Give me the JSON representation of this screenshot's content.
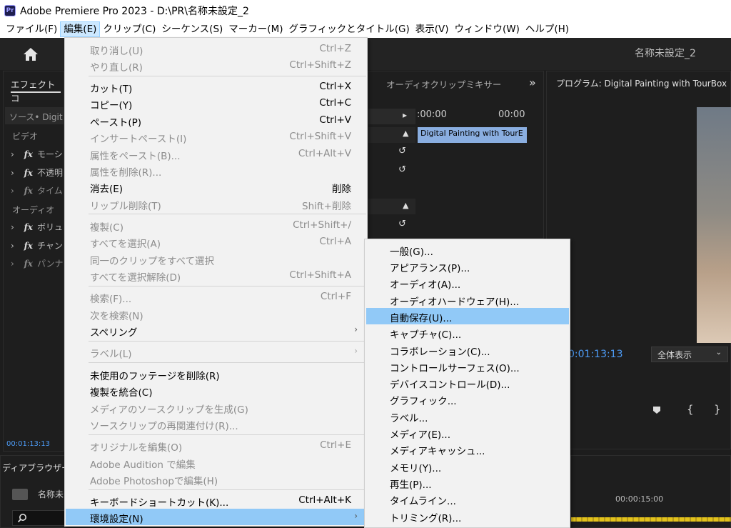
{
  "window": {
    "app_logo": "Pr",
    "title": "Adobe Premiere Pro 2023 - D:\\PR\\名称未設定_2"
  },
  "menubar": [
    {
      "label": "ファイル(F)"
    },
    {
      "label": "編集(E)"
    },
    {
      "label": "クリップ(C)"
    },
    {
      "label": "シーケンス(S)"
    },
    {
      "label": "マーカー(M)"
    },
    {
      "label": "グラフィックとタイトル(G)"
    },
    {
      "label": "表示(V)"
    },
    {
      "label": "ウィンドウ(W)"
    },
    {
      "label": "ヘルプ(H)"
    }
  ],
  "header": {
    "project_name": "名称未設定_2",
    "home_icon": "home-icon"
  },
  "effect_controls": {
    "tab_label": "エフェクトコ",
    "source_label": "ソース• Digit",
    "video_label": "ビデオ",
    "audio_label": "オーディオ",
    "timecode": "00:01:13:13",
    "fx_glyph": "fx",
    "rows": [
      "モーシ",
      "不透明",
      "タイム",
      "ボリュ",
      "チャン",
      "パンナ"
    ]
  },
  "source_panel": {
    "tab_label": "オーディオクリップミキサー",
    "expand_glyph": "»",
    "time_start": ":00:00",
    "time_end": "00:00",
    "clip_label": "Digital Painting with TourE"
  },
  "program_monitor": {
    "title": "プログラム: Digital Painting with TourBox",
    "timecode": "0:01:13:13",
    "zoom_option": "全体表示"
  },
  "media_browser": {
    "tab_label": "ディアブラウザー",
    "item_label": "名称未",
    "search_icon": "search-icon"
  },
  "timeline": {
    "time_label": "00:00:15:00"
  },
  "edit_menu": {
    "items": [
      {
        "label": "取り消し(U)",
        "shortcut": "Ctrl+Z"
      },
      {
        "label": "やり直し(R)",
        "shortcut": "Ctrl+Shift+Z"
      },
      {
        "label": "カット(T)",
        "shortcut": "Ctrl+X"
      },
      {
        "label": "コピー(Y)",
        "shortcut": "Ctrl+C"
      },
      {
        "label": "ペースト(P)",
        "shortcut": "Ctrl+V"
      },
      {
        "label": "インサートペースト(I)",
        "shortcut": "Ctrl+Shift+V"
      },
      {
        "label": "属性をペースト(B)...",
        "shortcut": "Ctrl+Alt+V"
      },
      {
        "label": "属性を削除(R)...",
        "shortcut": ""
      },
      {
        "label": "消去(E)",
        "shortcut": "削除"
      },
      {
        "label": "リップル削除(T)",
        "shortcut": "Shift+削除"
      },
      {
        "label": "複製(C)",
        "shortcut": "Ctrl+Shift+/"
      },
      {
        "label": "すべてを選択(A)",
        "shortcut": "Ctrl+A"
      },
      {
        "label": "同一のクリップをすべて選択",
        "shortcut": ""
      },
      {
        "label": "すべてを選択解除(D)",
        "shortcut": "Ctrl+Shift+A"
      },
      {
        "label": "検索(F)...",
        "shortcut": "Ctrl+F"
      },
      {
        "label": "次を検索(N)",
        "shortcut": ""
      },
      {
        "label": "スペリング",
        "shortcut": ""
      },
      {
        "label": "ラベル(L)",
        "shortcut": ""
      },
      {
        "label": "未使用のフッテージを削除(R)",
        "shortcut": ""
      },
      {
        "label": "複製を統合(C)",
        "shortcut": ""
      },
      {
        "label": "メディアのソースクリップを生成(G)",
        "shortcut": ""
      },
      {
        "label": "ソースクリップの再関連付け(R)...",
        "shortcut": ""
      },
      {
        "label": "オリジナルを編集(O)",
        "shortcut": "Ctrl+E"
      },
      {
        "label": "Adobe Audition で編集",
        "shortcut": ""
      },
      {
        "label": "Adobe Photoshopで編集(H)",
        "shortcut": ""
      },
      {
        "label": "キーボードショートカット(K)...",
        "shortcut": "Ctrl+Alt+K"
      },
      {
        "label": "環境設定(N)",
        "shortcut": ""
      }
    ],
    "submenu_arrow": "›"
  },
  "preferences_menu": {
    "items": [
      {
        "label": "一般(G)..."
      },
      {
        "label": "アピアランス(P)..."
      },
      {
        "label": "オーディオ(A)..."
      },
      {
        "label": "オーディオハードウェア(H)..."
      },
      {
        "label": "自動保存(U)..."
      },
      {
        "label": "キャプチャ(C)..."
      },
      {
        "label": "コラボレーション(C)..."
      },
      {
        "label": "コントロールサーフェス(O)..."
      },
      {
        "label": "デバイスコントロール(D)..."
      },
      {
        "label": "グラフィック..."
      },
      {
        "label": "ラベル..."
      },
      {
        "label": "メディア(E)..."
      },
      {
        "label": "メディアキャッシュ..."
      },
      {
        "label": "メモリ(Y)..."
      },
      {
        "label": "再生(P)..."
      },
      {
        "label": "タイムライン..."
      },
      {
        "label": "トリミング(R)..."
      }
    ]
  },
  "colors": {
    "highlight": "#91c9f7",
    "menu_bg": "#f2f2f2",
    "timecode_blue": "#4d9cf7",
    "clip_blue": "#8aaee0"
  }
}
